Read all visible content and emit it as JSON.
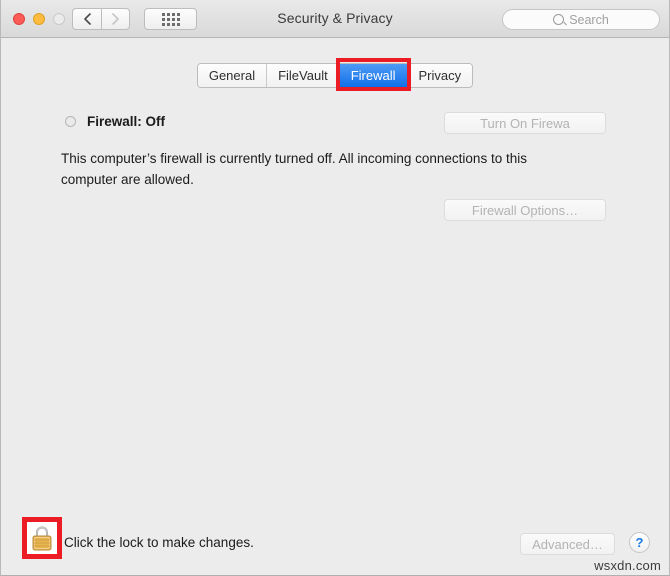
{
  "window": {
    "title": "Security & Privacy",
    "traffic_lights": [
      "close",
      "minimize",
      "zoom"
    ],
    "nav": {
      "back_icon": "chevron-left-icon",
      "forward_icon": "chevron-right-icon"
    },
    "grid_icon": "grid-dots-icon",
    "search": {
      "placeholder": "Search",
      "value": "",
      "icon": "search-icon"
    }
  },
  "tabs": [
    {
      "label": "General",
      "selected": false
    },
    {
      "label": "FileVault",
      "selected": false
    },
    {
      "label": "Firewall",
      "selected": true
    },
    {
      "label": "Privacy",
      "selected": false
    }
  ],
  "main": {
    "status_label": "Firewall: Off",
    "status_indicator": "off",
    "description": "This computer’s firewall is currently turned off. All incoming connections to this computer are allowed.",
    "turn_on_button": "Turn On Firewa",
    "options_button": "Firewall Options…"
  },
  "footer": {
    "lock_icon": "padlock-icon",
    "lock_message": "Click the lock to make changes.",
    "advanced_button": "Advanced…",
    "help_button": "?",
    "watermark": "wsxdn.com"
  },
  "colors": {
    "accent_blue": "#1170e8",
    "highlight_red": "#ec1c24",
    "window_bg": "#ececec",
    "lock_gold": "#e8b44c"
  }
}
